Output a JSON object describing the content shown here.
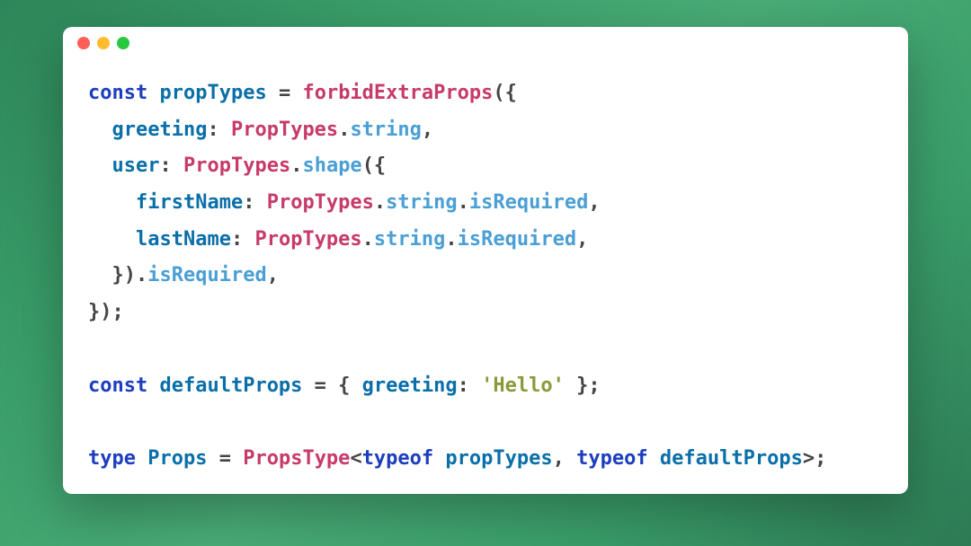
{
  "colors": {
    "keyword": "#1d3dbf",
    "identifier": "#0a6fa8",
    "type": "#c73a6a",
    "member": "#4a9fd4",
    "punct": "#444",
    "string": "#8a9a3a"
  },
  "code": {
    "line1": {
      "kw1": "const",
      "id1": "propTypes",
      "eq": " = ",
      "fn": "forbidExtraProps",
      "open": "({"
    },
    "line2": {
      "indent": "  ",
      "key": "greeting",
      "colon": ": ",
      "type": "PropTypes",
      "dot": ".",
      "member": "string",
      "comma": ","
    },
    "line3": {
      "indent": "  ",
      "key": "user",
      "colon": ": ",
      "type": "PropTypes",
      "dot": ".",
      "member": "shape",
      "open": "({"
    },
    "line4": {
      "indent": "    ",
      "key": "firstName",
      "colon": ": ",
      "type": "PropTypes",
      "dot1": ".",
      "m1": "string",
      "dot2": ".",
      "m2": "isRequired",
      "comma": ","
    },
    "line5": {
      "indent": "    ",
      "key": "lastName",
      "colon": ": ",
      "type": "PropTypes",
      "dot1": ".",
      "m1": "string",
      "dot2": ".",
      "m2": "isRequired",
      "comma": ","
    },
    "line6": {
      "indent": "  ",
      "close": "}).",
      "member": "isRequired",
      "comma": ","
    },
    "line7": {
      "close": "});"
    },
    "line8": {
      "kw1": "const",
      "id1": "defaultProps",
      "eq": " = { ",
      "key": "greeting",
      "colon": ": ",
      "str": "'Hello'",
      "close": " };"
    },
    "line9": {
      "kw1": "type",
      "id1": "Props",
      "eq": " = ",
      "type": "PropsType",
      "lt": "<",
      "kw2": "typeof",
      "sp1": " ",
      "id2": "propTypes",
      "comma": ", ",
      "kw3": "typeof",
      "sp2": " ",
      "id3": "defaultProps",
      "gt": ">;"
    }
  }
}
